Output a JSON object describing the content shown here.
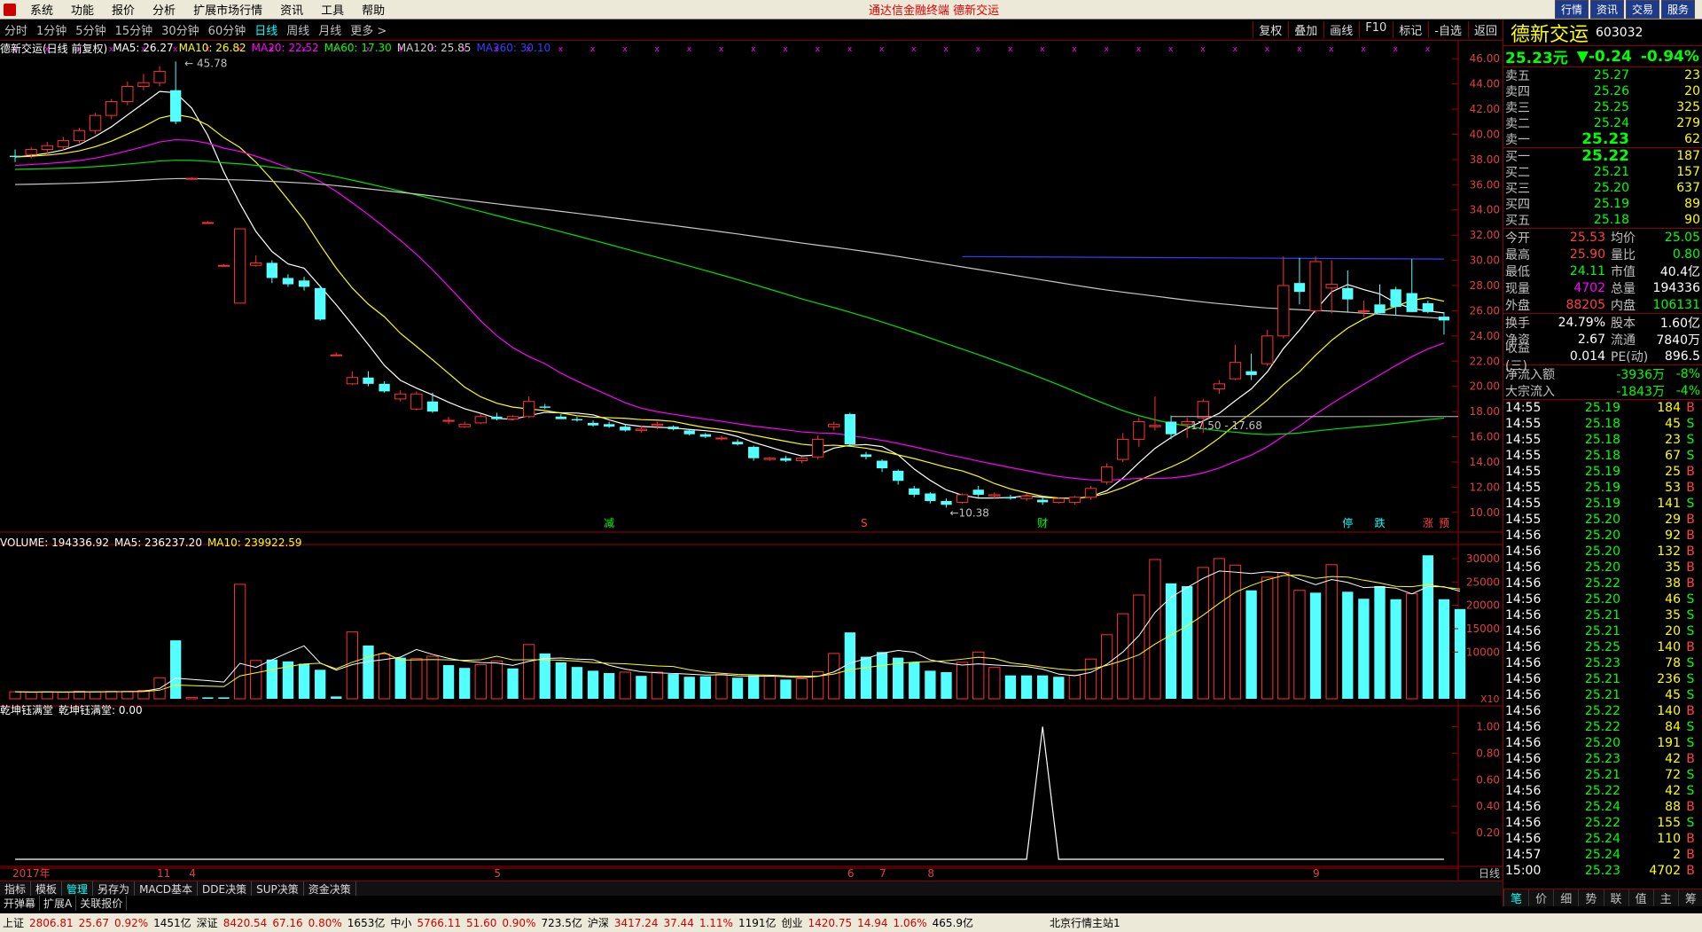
{
  "menubar": {
    "items": [
      "系统",
      "功能",
      "报价",
      "分析",
      "扩展市场行情",
      "资讯",
      "工具",
      "帮助"
    ],
    "center": "通达信金融终端   德新交运",
    "right": [
      "行情",
      "资讯",
      "交易",
      "服务"
    ]
  },
  "periods": [
    "分时",
    "1分钟",
    "5分钟",
    "15分钟",
    "30分钟",
    "60分钟",
    "日线",
    "周线",
    "月线",
    "更多 >"
  ],
  "tools": [
    "复权",
    "叠加",
    "画线",
    "F10",
    "标记",
    "-自选",
    "返回"
  ],
  "info": {
    "title": "德新交运(日线 前复权)",
    "ma5": "MA5: 26.27",
    "ma10": "MA10: 26.82",
    "ma20": "MA20: 22.52",
    "ma60": "MA60: 17.30",
    "ma120": "MA120: 25.85",
    "ma360": "MA360: 30.10"
  },
  "vol_info": {
    "v": "VOLUME: 194336.92",
    "ma5": "MA5: 236237.20",
    "ma10": "MA10: 239922.59"
  },
  "ind_info": {
    "a": "乾坤钰满堂",
    "b": "乾坤钰满堂: 0.00"
  },
  "quote": {
    "name": "德新交运",
    "code": "603032",
    "price": "25.23元",
    "change": "▼-0.24",
    "pct": "-0.94%",
    "sells": [
      [
        "卖五",
        "25.27",
        "23"
      ],
      [
        "卖四",
        "25.26",
        "20"
      ],
      [
        "卖三",
        "25.25",
        "325"
      ],
      [
        "卖二",
        "25.24",
        "279"
      ],
      [
        "卖一",
        "25.23",
        "62"
      ]
    ],
    "buys": [
      [
        "买一",
        "25.22",
        "187"
      ],
      [
        "买二",
        "25.21",
        "157"
      ],
      [
        "买三",
        "25.20",
        "637"
      ],
      [
        "买四",
        "25.19",
        "89"
      ],
      [
        "买五",
        "25.18",
        "90"
      ]
    ],
    "stats": [
      [
        "今开",
        "25.53",
        "均价",
        "25.05"
      ],
      [
        "最高",
        "25.90",
        "量比",
        "0.80"
      ],
      [
        "最低",
        "24.11",
        "市值",
        "40.4亿"
      ],
      [
        "现量",
        "4702",
        "总量",
        "194336"
      ],
      [
        "外盘",
        "88205",
        "内盘",
        "106131"
      ]
    ],
    "stats2": [
      [
        "换手",
        "24.79%",
        "股本",
        "1.60亿"
      ],
      [
        "净资",
        "2.67",
        "流通",
        "7840万"
      ],
      [
        "收益(三)",
        "0.014",
        "PE(动)",
        "896.5"
      ]
    ],
    "flows": [
      [
        "净流入额",
        "-3936万",
        "-8%"
      ],
      [
        "大宗流入",
        "-1843万",
        "-4%"
      ]
    ],
    "ticks": [
      [
        "14:55",
        "25.19",
        "184",
        "B"
      ],
      [
        "14:55",
        "25.18",
        "45",
        "S"
      ],
      [
        "14:55",
        "25.18",
        "23",
        "S"
      ],
      [
        "14:55",
        "25.18",
        "67",
        "S"
      ],
      [
        "14:55",
        "25.19",
        "25",
        "B"
      ],
      [
        "14:55",
        "25.19",
        "53",
        "B"
      ],
      [
        "14:55",
        "25.19",
        "141",
        "S"
      ],
      [
        "14:55",
        "25.20",
        "29",
        "B"
      ],
      [
        "14:56",
        "25.20",
        "92",
        "B"
      ],
      [
        "14:56",
        "25.20",
        "132",
        "B"
      ],
      [
        "14:56",
        "25.20",
        "35",
        "B"
      ],
      [
        "14:56",
        "25.22",
        "38",
        "B"
      ],
      [
        "14:56",
        "25.20",
        "46",
        "S"
      ],
      [
        "14:56",
        "25.21",
        "35",
        "S"
      ],
      [
        "14:56",
        "25.21",
        "20",
        "S"
      ],
      [
        "14:56",
        "25.25",
        "140",
        "B"
      ],
      [
        "14:56",
        "25.23",
        "78",
        "S"
      ],
      [
        "14:56",
        "25.21",
        "236",
        "S"
      ],
      [
        "14:56",
        "25.21",
        "45",
        "S"
      ],
      [
        "14:56",
        "25.22",
        "140",
        "B"
      ],
      [
        "14:56",
        "25.22",
        "84",
        "S"
      ],
      [
        "14:56",
        "25.20",
        "191",
        "S"
      ],
      [
        "14:56",
        "25.23",
        "42",
        "B"
      ],
      [
        "14:56",
        "25.21",
        "72",
        "S"
      ],
      [
        "14:56",
        "25.22",
        "42",
        "S"
      ],
      [
        "14:56",
        "25.24",
        "88",
        "B"
      ],
      [
        "14:56",
        "25.22",
        "155",
        "S"
      ],
      [
        "14:56",
        "25.24",
        "110",
        "B"
      ],
      [
        "14:57",
        "25.24",
        "2",
        "B"
      ],
      [
        "15:00",
        "25.23",
        "4702",
        "B"
      ]
    ],
    "tabs": [
      "笔",
      "价",
      "细",
      "势",
      "联",
      "值",
      "主",
      "筹"
    ]
  },
  "bottom_tabs": [
    "指标",
    "模板",
    "管理",
    "另存为",
    "MACD基本",
    "DDE决策",
    "SUP决策",
    "资金决策"
  ],
  "bottom_tabs2": [
    "开弹幕",
    "扩展A",
    "关联报价"
  ],
  "status": [
    "上证",
    "2806.81",
    "25.67",
    "0.92%",
    "1451亿",
    "深证",
    "8420.54",
    "67.16",
    "0.80%",
    "1653亿",
    "中小",
    "5766.11",
    "51.60",
    "0.90%",
    "723.5亿",
    "沪深",
    "3417.24",
    "37.44",
    "1.11%",
    "1191亿",
    "创业",
    "1420.75",
    "14.94",
    "1.06%",
    "465.9亿",
    "北京行情主站1"
  ],
  "chart_data": {
    "type": "candlestick",
    "price_axis": [
      46,
      44,
      42,
      40,
      38,
      36,
      34,
      32,
      30,
      28,
      26,
      24,
      22,
      20,
      18,
      16,
      14,
      12,
      10
    ],
    "price_range": [
      9,
      47
    ],
    "volume_axis": [
      30000,
      25000,
      20000,
      15000,
      10000
    ],
    "volume_unit": "X10",
    "indicator_axis": [
      1.0,
      0.8,
      0.6,
      0.4,
      0.2
    ],
    "x_labels": [
      [
        "2017年",
        0
      ],
      [
        "11",
        9
      ],
      [
        "4",
        11
      ],
      [
        "5",
        30
      ],
      [
        "6",
        52
      ],
      [
        "7",
        54
      ],
      [
        "8",
        57
      ],
      [
        "9",
        81
      ]
    ],
    "axis_right_label": "日线",
    "annotations": {
      "high": "45.78",
      "low": "10.38",
      "range": "17.50 - 17.68"
    },
    "markers": [
      [
        "减",
        37
      ],
      [
        "S",
        53
      ],
      [
        "财",
        64
      ],
      [
        "停",
        83
      ],
      [
        "跌",
        85
      ],
      [
        "涨",
        88
      ],
      [
        "预",
        89
      ]
    ],
    "candles": [
      [
        38.3,
        38.8,
        37.8,
        38.2
      ],
      [
        38.4,
        39.0,
        38.1,
        38.8
      ],
      [
        38.8,
        39.4,
        38.4,
        39.1
      ],
      [
        39.0,
        39.8,
        38.7,
        39.5
      ],
      [
        39.5,
        40.5,
        39.3,
        40.3
      ],
      [
        40.3,
        41.7,
        40.0,
        41.5
      ],
      [
        41.5,
        42.8,
        41.2,
        42.6
      ],
      [
        42.6,
        44.2,
        42.3,
        43.8
      ],
      [
        43.8,
        44.8,
        43.5,
        44.1
      ],
      [
        44.1,
        45.4,
        43.8,
        45.0
      ],
      [
        43.5,
        45.78,
        40.8,
        41.0
      ],
      [
        36.5,
        36.6,
        36.4,
        36.5
      ],
      [
        33.0,
        33.1,
        32.9,
        33.0
      ],
      [
        29.6,
        29.7,
        29.5,
        29.6
      ],
      [
        26.6,
        32.5,
        26.6,
        32.5
      ],
      [
        29.6,
        30.4,
        29.5,
        29.8
      ],
      [
        29.8,
        30.0,
        28.2,
        28.6
      ],
      [
        28.6,
        28.9,
        27.9,
        28.1
      ],
      [
        28.4,
        28.7,
        27.6,
        27.9
      ],
      [
        27.8,
        28.0,
        25.2,
        25.3
      ],
      [
        22.5,
        22.7,
        22.4,
        22.5
      ],
      [
        20.2,
        21.2,
        20.1,
        20.7
      ],
      [
        20.7,
        21.2,
        20.0,
        20.2
      ],
      [
        20.2,
        20.4,
        19.5,
        19.6
      ],
      [
        19.0,
        19.7,
        18.8,
        19.4
      ],
      [
        18.2,
        19.6,
        18.1,
        19.4
      ],
      [
        18.8,
        19.5,
        17.9,
        18.0
      ],
      [
        17.3,
        17.6,
        17.0,
        17.3
      ],
      [
        16.8,
        17.2,
        16.7,
        17.0
      ],
      [
        17.1,
        17.8,
        17.0,
        17.6
      ],
      [
        17.6,
        17.9,
        17.3,
        17.4
      ],
      [
        17.4,
        17.7,
        17.3,
        17.6
      ],
      [
        17.6,
        19.2,
        17.5,
        18.8
      ],
      [
        18.4,
        18.6,
        18.2,
        18.3
      ],
      [
        17.6,
        17.8,
        17.4,
        17.4
      ],
      [
        17.4,
        17.6,
        17.2,
        17.3
      ],
      [
        17.1,
        17.3,
        16.8,
        16.9
      ],
      [
        17.0,
        17.2,
        16.7,
        16.8
      ],
      [
        16.8,
        17.0,
        16.4,
        16.5
      ],
      [
        16.5,
        16.9,
        16.3,
        16.6
      ],
      [
        16.9,
        17.2,
        16.6,
        17.0
      ],
      [
        16.8,
        16.9,
        16.5,
        16.6
      ],
      [
        16.5,
        16.6,
        16.1,
        16.2
      ],
      [
        16.2,
        16.3,
        15.9,
        16.0
      ],
      [
        15.9,
        16.1,
        15.7,
        15.9
      ],
      [
        15.6,
        15.8,
        15.3,
        15.4
      ],
      [
        15.2,
        15.3,
        14.1,
        14.3
      ],
      [
        14.2,
        14.4,
        14.1,
        14.3
      ],
      [
        14.3,
        14.5,
        14.0,
        14.1
      ],
      [
        14.1,
        14.4,
        13.9,
        14.3
      ],
      [
        14.4,
        16.1,
        14.2,
        15.8
      ],
      [
        16.8,
        17.2,
        16.5,
        17.0
      ],
      [
        17.8,
        17.9,
        15.2,
        15.4
      ],
      [
        14.6,
        14.8,
        14.2,
        14.4
      ],
      [
        14.1,
        14.2,
        13.2,
        13.5
      ],
      [
        13.3,
        13.4,
        12.2,
        12.5
      ],
      [
        11.9,
        12.1,
        11.2,
        11.4
      ],
      [
        11.5,
        11.6,
        10.7,
        10.9
      ],
      [
        10.9,
        11.1,
        10.38,
        10.6
      ],
      [
        10.8,
        11.5,
        10.7,
        11.4
      ],
      [
        11.8,
        12.1,
        11.2,
        11.4
      ],
      [
        11.3,
        11.6,
        11.1,
        11.4
      ],
      [
        11.2,
        11.4,
        11.0,
        11.1
      ],
      [
        11.1,
        11.5,
        10.9,
        11.3
      ],
      [
        11.0,
        11.3,
        10.6,
        10.8
      ],
      [
        10.8,
        11.2,
        10.7,
        11.1
      ],
      [
        10.8,
        11.3,
        10.6,
        11.2
      ],
      [
        11.2,
        12.1,
        11.0,
        11.9
      ],
      [
        12.4,
        13.9,
        12.2,
        13.6
      ],
      [
        14.2,
        16.3,
        14.0,
        15.8
      ],
      [
        15.8,
        17.5,
        15.2,
        17.2
      ],
      [
        16.8,
        19.2,
        16.5,
        16.9
      ],
      [
        17.2,
        17.68,
        15.8,
        16.2
      ],
      [
        17.0,
        17.5,
        15.9,
        17.2
      ],
      [
        17.5,
        19.0,
        16.3,
        18.8
      ],
      [
        19.8,
        20.5,
        19.4,
        20.2
      ],
      [
        20.6,
        23.3,
        20.5,
        21.9
      ],
      [
        21.2,
        22.6,
        20.5,
        20.9
      ],
      [
        21.8,
        24.5,
        21.6,
        24.0
      ],
      [
        24.0,
        30.3,
        23.8,
        28.0
      ],
      [
        28.2,
        30.2,
        26.5,
        27.5
      ],
      [
        26.0,
        30.3,
        25.8,
        29.9
      ],
      [
        27.8,
        30.0,
        25.8,
        28.1
      ],
      [
        27.8,
        29.2,
        25.9,
        26.9
      ],
      [
        26.0,
        26.8,
        25.5,
        26.0
      ],
      [
        26.5,
        28.1,
        25.8,
        25.8
      ],
      [
        27.7,
        27.9,
        25.6,
        26.3
      ],
      [
        27.4,
        30.1,
        25.9,
        25.9
      ],
      [
        26.6,
        26.8,
        25.8,
        25.9
      ],
      [
        25.53,
        25.9,
        24.11,
        25.23
      ]
    ],
    "volumes": [
      [
        1500,
        1
      ],
      [
        1400,
        1
      ],
      [
        1500,
        1
      ],
      [
        1400,
        1
      ],
      [
        1600,
        1
      ],
      [
        1500,
        1
      ],
      [
        1600,
        1
      ],
      [
        1600,
        1
      ],
      [
        1800,
        1
      ],
      [
        4500,
        1
      ],
      [
        12500,
        0
      ],
      [
        300,
        1
      ],
      [
        300,
        0
      ],
      [
        300,
        0
      ],
      [
        24500,
        1
      ],
      [
        8200,
        1
      ],
      [
        8400,
        0
      ],
      [
        8000,
        0
      ],
      [
        7500,
        0
      ],
      [
        6200,
        0
      ],
      [
        500,
        0
      ],
      [
        14300,
        1
      ],
      [
        11400,
        0
      ],
      [
        9600,
        1
      ],
      [
        8800,
        0
      ],
      [
        8600,
        1
      ],
      [
        9100,
        1
      ],
      [
        7200,
        0
      ],
      [
        6600,
        0
      ],
      [
        7300,
        1
      ],
      [
        8100,
        1
      ],
      [
        6500,
        0
      ],
      [
        11600,
        1
      ],
      [
        9700,
        0
      ],
      [
        7800,
        0
      ],
      [
        6800,
        0
      ],
      [
        6000,
        0
      ],
      [
        5500,
        0
      ],
      [
        5700,
        1
      ],
      [
        4900,
        0
      ],
      [
        5700,
        1
      ],
      [
        5300,
        0
      ],
      [
        4700,
        0
      ],
      [
        4800,
        0
      ],
      [
        5200,
        1
      ],
      [
        4500,
        0
      ],
      [
        5000,
        0
      ],
      [
        4800,
        1
      ],
      [
        4100,
        0
      ],
      [
        4300,
        1
      ],
      [
        5800,
        1
      ],
      [
        9700,
        1
      ],
      [
        14200,
        0
      ],
      [
        9000,
        0
      ],
      [
        10000,
        0
      ],
      [
        8800,
        0
      ],
      [
        7800,
        0
      ],
      [
        6000,
        0
      ],
      [
        5700,
        0
      ],
      [
        7800,
        1
      ],
      [
        10000,
        1
      ],
      [
        6700,
        1
      ],
      [
        5000,
        0
      ],
      [
        5000,
        0
      ],
      [
        5000,
        0
      ],
      [
        4700,
        0
      ],
      [
        5000,
        1
      ],
      [
        8500,
        1
      ],
      [
        13700,
        1
      ],
      [
        18200,
        1
      ],
      [
        22200,
        1
      ],
      [
        29800,
        1
      ],
      [
        24700,
        0
      ],
      [
        24100,
        0
      ],
      [
        28100,
        1
      ],
      [
        30000,
        1
      ],
      [
        28600,
        1
      ],
      [
        23200,
        0
      ],
      [
        26000,
        1
      ],
      [
        27000,
        1
      ],
      [
        23200,
        1
      ],
      [
        22700,
        0
      ],
      [
        28700,
        1
      ],
      [
        22900,
        0
      ],
      [
        21400,
        0
      ],
      [
        24100,
        0
      ],
      [
        21300,
        0
      ],
      [
        22500,
        1
      ],
      [
        30700,
        0
      ],
      [
        21300,
        0
      ],
      [
        19200,
        0
      ]
    ],
    "indicator_series": [
      [
        63,
        0
      ],
      [
        64,
        1.0
      ],
      [
        65,
        0
      ]
    ],
    "indicator_span": 90
  }
}
